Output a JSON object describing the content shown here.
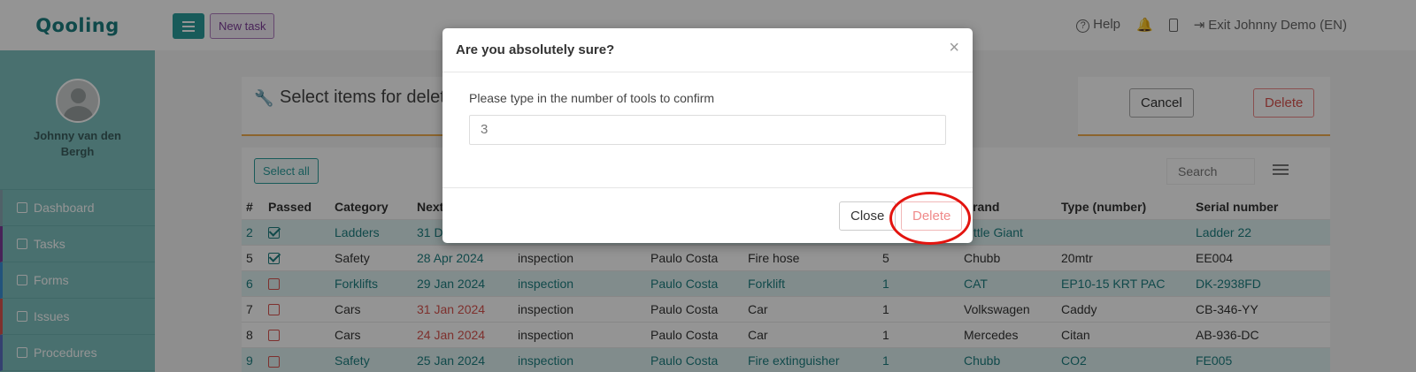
{
  "app": {
    "logo": "Qooling"
  },
  "topbar": {
    "new_task": "New task",
    "help": "Help",
    "exit": "Exit Johnny Demo (EN)"
  },
  "sidebar": {
    "user_name": "Johnny van den Bergh",
    "items": [
      {
        "label": "Dashboard"
      },
      {
        "label": "Tasks"
      },
      {
        "label": "Forms"
      },
      {
        "label": "Issues"
      },
      {
        "label": "Procedures"
      }
    ]
  },
  "page": {
    "title": "Select items for delet",
    "cancel": "Cancel",
    "delete": "Delete",
    "select_all": "Select all",
    "search_placeholder": "Search"
  },
  "table": {
    "headers": {
      "num": "#",
      "passed": "Passed",
      "category": "Category",
      "next": "Next",
      "brand": "Brand",
      "type": "Type (number)",
      "serial": "Serial number"
    },
    "rows": [
      {
        "num": "2",
        "passed": true,
        "category": "Ladders",
        "next": "31 D",
        "task": "",
        "person": "",
        "item": "",
        "qty": "",
        "brand": "Little Giant",
        "type": "",
        "serial": "Ladder 22"
      },
      {
        "num": "5",
        "passed": true,
        "category": "Safety",
        "next": "28 Apr 2024",
        "task": "inspection",
        "person": "Paulo Costa",
        "item": "Fire hose",
        "qty": "5",
        "brand": "Chubb",
        "type": "20mtr",
        "serial": "EE004"
      },
      {
        "num": "6",
        "passed": false,
        "category": "Forklifts",
        "next": "29 Jan 2024",
        "task": "inspection",
        "person": "Paulo Costa",
        "item": "Forklift",
        "qty": "1",
        "brand": "CAT",
        "type": "EP10-15 KRT PAC",
        "serial": "DK-2938FD"
      },
      {
        "num": "7",
        "passed": false,
        "category": "Cars",
        "next": "31 Jan 2024",
        "task": "inspection",
        "person": "Paulo Costa",
        "item": "Car",
        "qty": "1",
        "brand": "Volkswagen",
        "type": "Caddy",
        "serial": "CB-346-YY"
      },
      {
        "num": "8",
        "passed": false,
        "category": "Cars",
        "next": "24 Jan 2024",
        "task": "inspection",
        "person": "Paulo Costa",
        "item": "Car",
        "qty": "1",
        "brand": "Mercedes",
        "type": "Citan",
        "serial": "AB-936-DC"
      },
      {
        "num": "9",
        "passed": false,
        "category": "Safety",
        "next": "25 Jan 2024",
        "task": "inspection",
        "person": "Paulo Costa",
        "item": "Fire extinguisher",
        "qty": "1",
        "brand": "Chubb",
        "type": "CO2",
        "serial": "FE005"
      }
    ]
  },
  "modal": {
    "title": "Are you absolutely sure?",
    "close_x": "×",
    "label": "Please type in the number of tools to confirm",
    "input_value": "3",
    "close": "Close",
    "delete": "Delete"
  }
}
